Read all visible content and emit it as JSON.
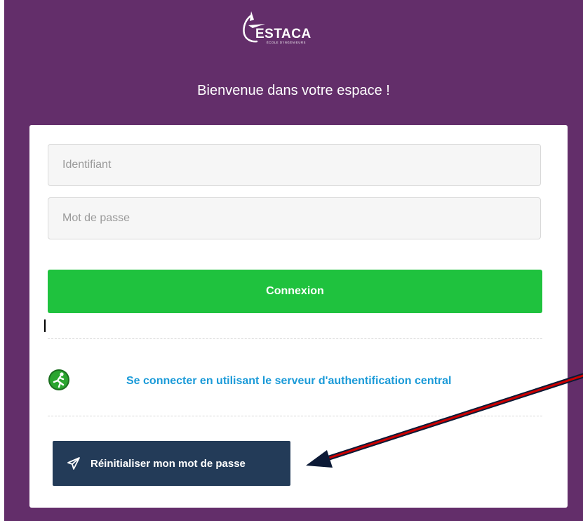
{
  "header": {
    "logo_text": "ESTACA",
    "logo_subtext": "ÉCOLE D'INGÉNIEURS",
    "welcome": "Bienvenue dans votre espace !"
  },
  "login_form": {
    "username_placeholder": "Identifiant",
    "password_placeholder": "Mot de passe",
    "connect_label": "Connexion"
  },
  "cas": {
    "icon": "runner-icon",
    "link_label": "Se connecter en utilisant le serveur d'authentification central"
  },
  "reset": {
    "icon": "paper-plane-icon",
    "label": "Réinitialiser mon mot de passe"
  },
  "colors": {
    "header_bg": "#632e6a",
    "connect_bg": "#1fc23e",
    "link": "#1a9ad8",
    "reset_bg": "#233b58",
    "annotation_arrow": "#cc0000"
  }
}
